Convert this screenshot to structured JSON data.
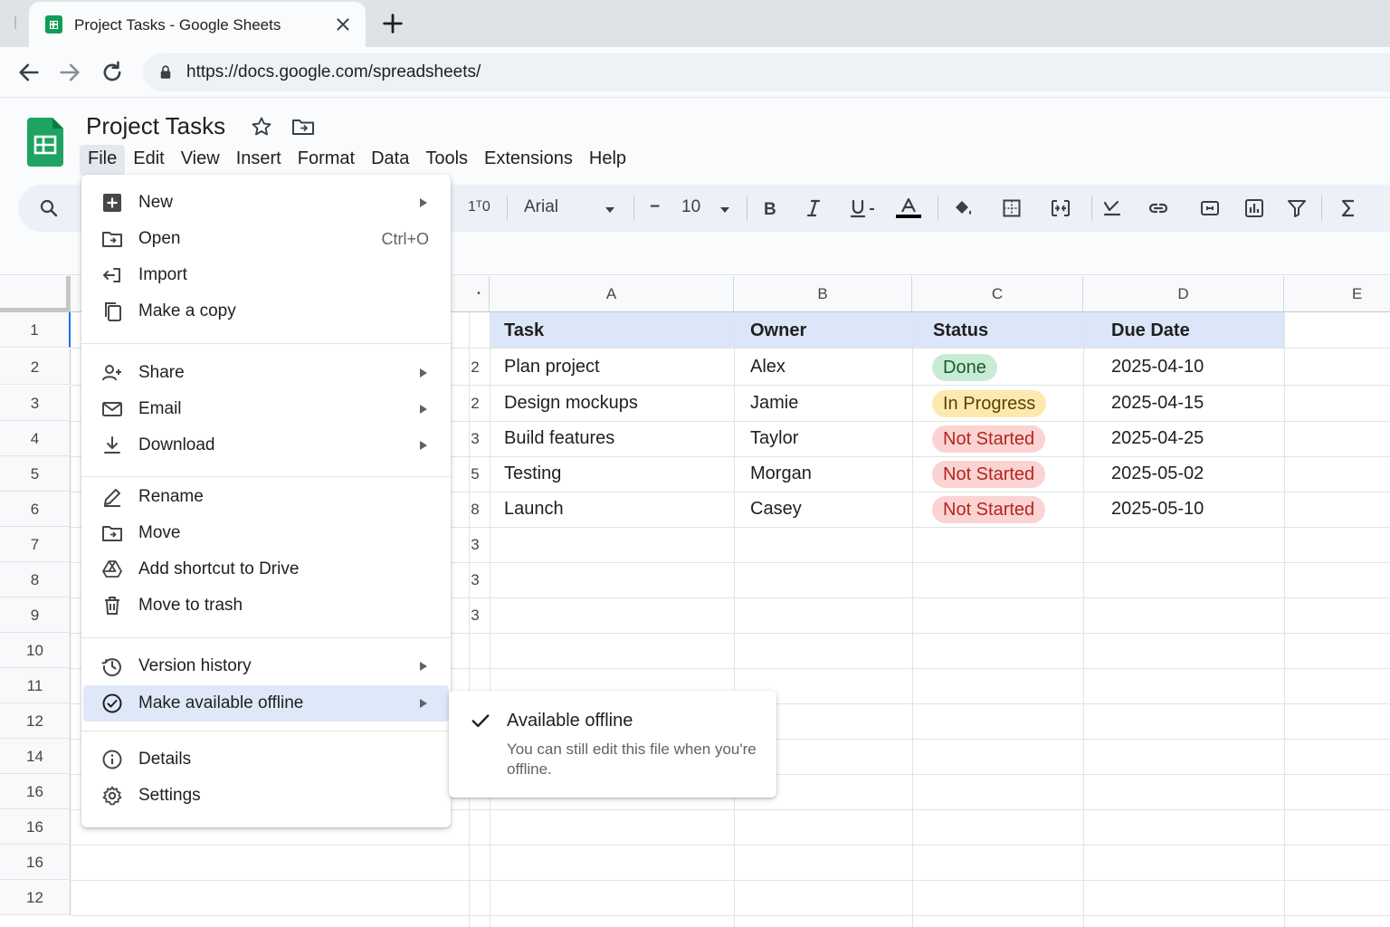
{
  "browser": {
    "tab_title": "Project Tasks - Google Sheets",
    "url": "https://docs.google.com/spreadsheets/"
  },
  "doc": {
    "title": "Project Tasks"
  },
  "menubar": [
    "File",
    "Edit",
    "View",
    "Insert",
    "Format",
    "Data",
    "Tools",
    "Extensions",
    "Help"
  ],
  "toolbar": {
    "format_partial": "1ᵀ0",
    "font": "Arial",
    "font_size": "10",
    "minus": "−"
  },
  "columns": [
    "A",
    "B",
    "C",
    "D",
    "E"
  ],
  "row_numbers": [
    "1",
    "2",
    "3",
    "4",
    "5",
    "6",
    "7",
    "8",
    "9",
    "10",
    "11",
    "12",
    "14",
    "16",
    "16",
    "16",
    "12"
  ],
  "hidden_column_digits": [
    "2",
    "2",
    "3",
    "5",
    "8",
    "3",
    "3",
    "3"
  ],
  "table": {
    "headers": [
      "Task",
      "Owner",
      "Status",
      "Due Date"
    ],
    "rows": [
      {
        "task": "Plan project",
        "owner": "Alex",
        "status": "Done",
        "due": "2025-04-10"
      },
      {
        "task": "Design mockups",
        "owner": "Jamie",
        "status": "In Progress",
        "due": "2025-04-15"
      },
      {
        "task": "Build features",
        "owner": "Taylor",
        "status": "Not Started",
        "due": "2025-04-25"
      },
      {
        "task": "Testing",
        "owner": "Morgan",
        "status": "Not Started",
        "due": "2025-05-02"
      },
      {
        "task": "Launch",
        "owner": "Casey",
        "status": "Not Started",
        "due": "2025-05-10"
      }
    ]
  },
  "file_menu": {
    "new": "New",
    "open": "Open",
    "open_shortcut": "Ctrl+O",
    "import": "Import",
    "make_copy": "Make a copy",
    "share": "Share",
    "email": "Email",
    "download": "Download",
    "rename": "Rename",
    "move": "Move",
    "add_shortcut": "Add shortcut to Drive",
    "trash": "Move to trash",
    "version_history": "Version history",
    "offline": "Make available offline",
    "details": "Details",
    "settings": "Settings"
  },
  "offline_submenu": {
    "title": "Available offline",
    "description": "You can still edit this file when you're offline."
  },
  "colors": {
    "sheets_green": "#0f9d58",
    "accent_blue": "#1a73e8",
    "header_band": "#dbe7f8",
    "done_bg": "#c8ebd4",
    "in_progress_bg": "#fde9b0",
    "not_started_bg": "#fbd3d2"
  }
}
